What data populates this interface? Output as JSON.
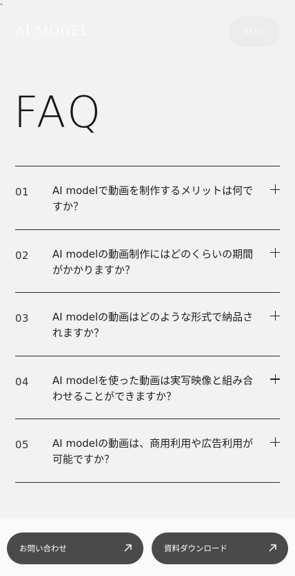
{
  "top_marker": "-",
  "header": {
    "logo": "AI MODEL",
    "menu_label": "MENU"
  },
  "page_title": "FAQ",
  "faq": [
    {
      "number": "01",
      "question": "AI modelで動画を制作するメリットは何ですか？"
    },
    {
      "number": "02",
      "question": "AI modelの動画制作にはどのくらいの期間がかかりますか？"
    },
    {
      "number": "03",
      "question": "AI modelの動画はどのような形式で納品されますか？"
    },
    {
      "number": "04",
      "question": "AI modelを使った動画は実写映像と組み合わせることができますか？"
    },
    {
      "number": "05",
      "question": "AI modelの動画は、商用利用や広告利用が可能ですか？"
    }
  ],
  "footer_buttons": {
    "contact_label": "お問い合わせ",
    "download_label": "資料ダウンロード"
  },
  "icons": {
    "expand": "plus-icon",
    "external": "arrow-up-right-icon"
  },
  "colors": {
    "background": "#f2f2f2",
    "text": "#1c1c1c",
    "button": "#4a4a4a"
  }
}
